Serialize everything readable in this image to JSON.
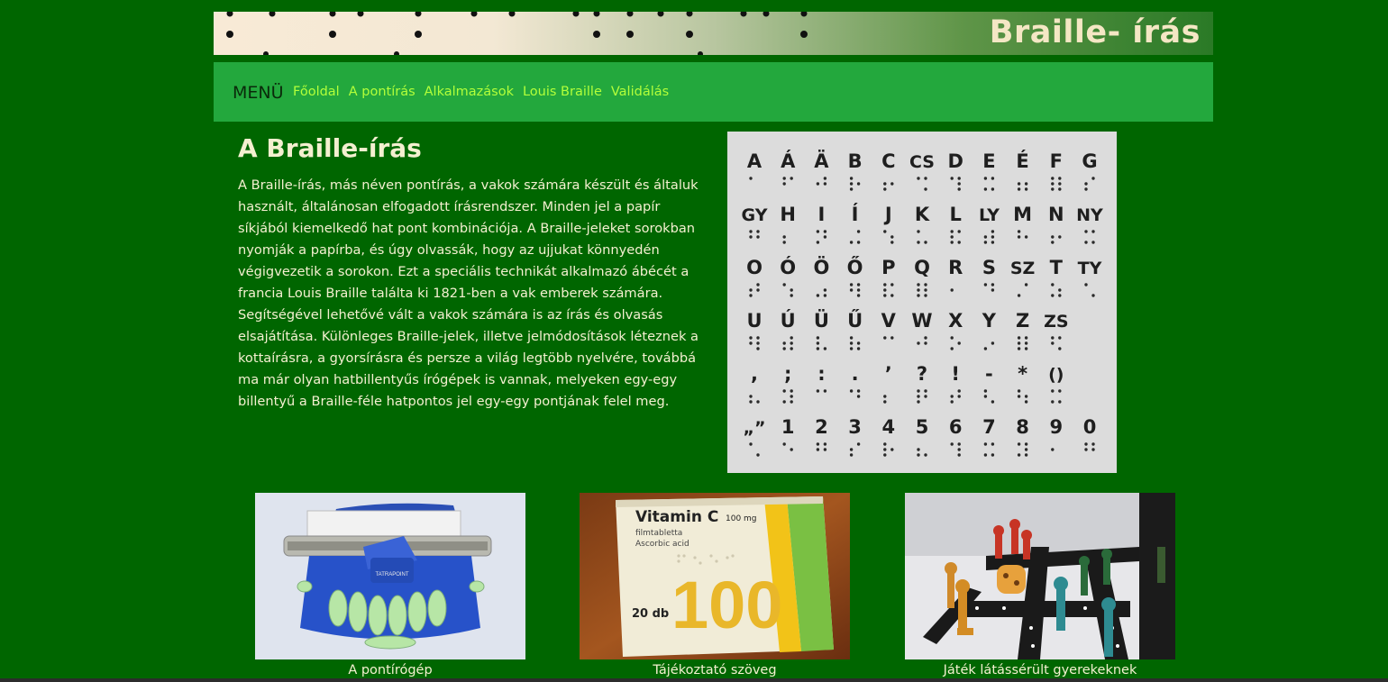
{
  "header": {
    "site_title": "Braille- írás"
  },
  "nav": {
    "menu_label": "MENÜ",
    "links": [
      "Főoldal",
      "A pontírás",
      "Alkalmazások",
      "Louis Braille",
      "Validálás"
    ]
  },
  "main": {
    "heading": "A Braille-írás",
    "paragraph": "A Braille-írás, más néven pontírás, a vakok számára készült és általuk használt, általánosan elfogadott írásrendszer. Minden jel a papír síkjából kiemelkedő hat pont kombinációja. A Braille-jeleket sorokban nyomják a papírba, és úgy olvassák, hogy az ujjukat könnyedén végigvezetik a sorokon. Ezt a speciális technikát alkalmazó ábécét a francia Louis Braille találta ki 1821-ben a vak emberek számára. Segítségével lehetővé vált a vakok számára is az írás és olvasás elsajátítása. Különleges Braille-jelek, illetve jelmódosítások léteznek a kottaírásra, a gyorsírásra és persze a világ legtöbb nyelvére, továbbá ma már olyan hatbillentyűs írógépek is vannak, melyeken egy-egy billentyű a Braille-féle hatpontos jel egy-egy pontjának felel meg."
  },
  "braille_chart": {
    "rows": [
      [
        "A",
        "Á",
        "Ä",
        "B",
        "C",
        "CS",
        "D",
        "E",
        "É",
        "F",
        "G"
      ],
      [
        "GY",
        "H",
        "I",
        "Í",
        "J",
        "K",
        "L",
        "LY",
        "M",
        "N",
        "NY"
      ],
      [
        "O",
        "Ó",
        "Ö",
        "Ő",
        "P",
        "Q",
        "R",
        "S",
        "SZ",
        "T",
        "TY"
      ],
      [
        "U",
        "Ú",
        "Ü",
        "Ű",
        "V",
        "W",
        "X",
        "Y",
        "Z",
        "ZS"
      ],
      [
        ",",
        ";",
        ":",
        ".",
        "’",
        "?",
        "!",
        "-",
        "*",
        "()"
      ],
      [
        "„”",
        "1",
        "2",
        "3",
        "4",
        "5",
        "6",
        "7",
        "8",
        "9",
        "0"
      ]
    ]
  },
  "gallery": [
    {
      "caption": "A pontírógép",
      "embossed_text": "TATRAPOINT"
    },
    {
      "caption": "Tájékoztató szöveg",
      "box_title": "Vitamin C",
      "box_dose": "100 mg",
      "box_sub1": "filmtabletta",
      "box_sub2": "Ascorbic acid",
      "box_count": "20 db",
      "box_big": "100"
    },
    {
      "caption": "Játék látássérült gyerekeknek"
    }
  ],
  "colors": {
    "page_bg": "#006600",
    "nav_bg": "#23a83d",
    "nav_link": "#b3ff3a",
    "text": "#f4f0d0"
  }
}
